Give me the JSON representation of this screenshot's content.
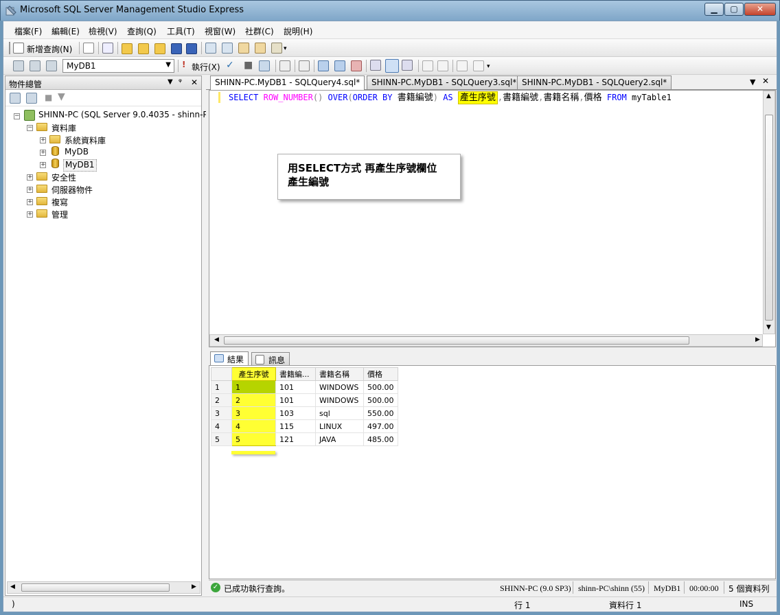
{
  "window": {
    "title": "Microsoft SQL Server Management Studio Express",
    "min": "▁",
    "max": "▢",
    "close": "✕"
  },
  "menu": [
    "檔案(F)",
    "編輯(E)",
    "檢視(V)",
    "查詢(Q)",
    "工具(T)",
    "視窗(W)",
    "社群(C)",
    "說明(H)"
  ],
  "toolbar1": {
    "new_query": "新增查詢(N)"
  },
  "toolbar2": {
    "database": "MyDB1",
    "execute": "執行(X)"
  },
  "object_explorer": {
    "title": "物件總管",
    "pin": "ᵠ",
    "close": "✕",
    "server": "SHINN-PC (SQL Server 9.0.4035 - shinn-PC",
    "nodes": {
      "databases": "資料庫",
      "system_databases": "系統資料庫",
      "mydb": "MyDB",
      "mydb1": "MyDB1",
      "security": "安全性",
      "server_objects": "伺服器物件",
      "replication": "複寫",
      "management": "管理"
    }
  },
  "tabs": [
    {
      "label": "SHINN-PC.MyDB1 - SQLQuery4.sql*",
      "active": true
    },
    {
      "label": "SHINN-PC.MyDB1 - SQLQuery3.sql*",
      "active": false
    },
    {
      "label": "SHINN-PC.MyDB1 - SQLQuery2.sql*",
      "active": false
    }
  ],
  "editor": {
    "kw_select": "SELECT",
    "fn_row_number": "ROW_NUMBER",
    "paren": "()",
    "kw_over": "OVER",
    "paren_open": "(",
    "kw_order_by": "ORDER BY",
    "col_id": "書籍編號",
    "paren_close": ")",
    "kw_as": "AS",
    "alias": "產生序號",
    "comma": ",",
    "col_name": "書籍名稱",
    "col_price": "價格",
    "kw_from": "FROM",
    "table": "myTable1"
  },
  "annotation": "用SELECT方式  再產生序號欄位 產生編號",
  "results": {
    "tab_results": "結果",
    "tab_messages": "訊息",
    "columns": [
      "產生序號",
      "書籍編...",
      "書籍名稱",
      "價格"
    ],
    "rows": [
      [
        "1",
        "1",
        "101",
        "WINDOWS",
        "500.00"
      ],
      [
        "2",
        "2",
        "101",
        "WINDOWS",
        "500.00"
      ],
      [
        "3",
        "3",
        "103",
        "sql",
        "550.00"
      ],
      [
        "4",
        "4",
        "115",
        "LINUX",
        "497.00"
      ],
      [
        "5",
        "5",
        "121",
        "JAVA",
        "485.00"
      ]
    ]
  },
  "query_status": {
    "message": "已成功執行查詢。",
    "server": "SHINN-PC (9.0 SP3)",
    "user": "shinn-PC\\shinn (55)",
    "database": "MyDB1",
    "elapsed": "00:00:00",
    "rows": "5 個資料列"
  },
  "statusbar": {
    "left": ")",
    "line": "行 1",
    "row": "資料行 1",
    "mode": "INS"
  },
  "colors": {
    "highlight": "#ffff00",
    "keyword": "#0000ff",
    "function": "#ff00ff"
  }
}
